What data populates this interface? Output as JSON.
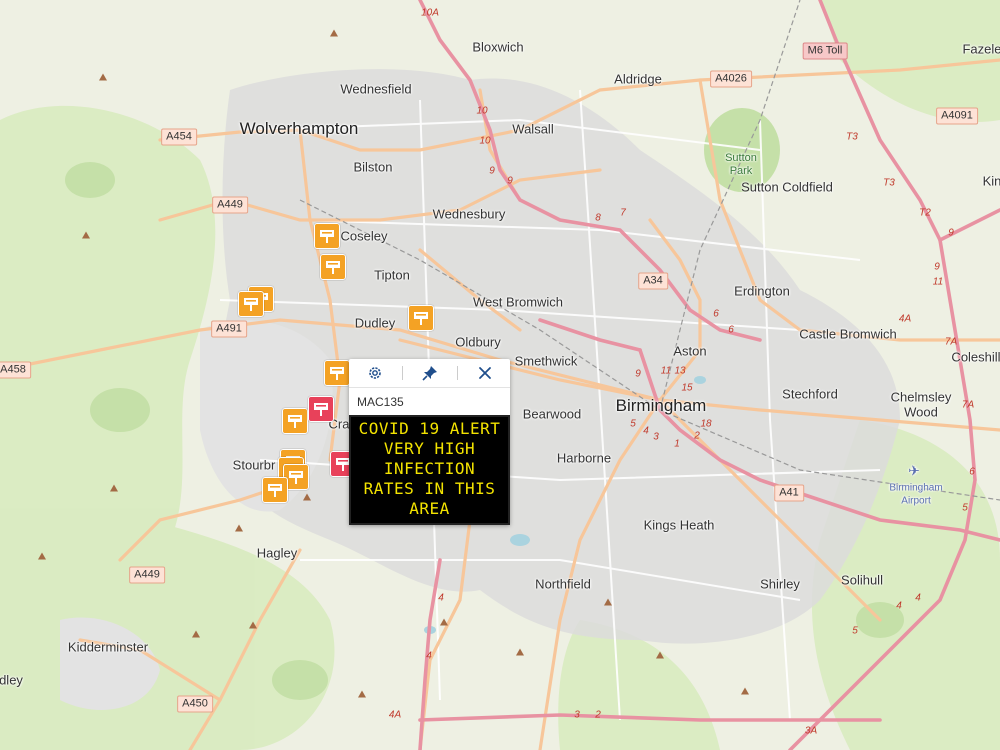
{
  "map": {
    "places": [
      {
        "name": "Wolverhampton",
        "kind": "city"
      },
      {
        "name": "Birmingham",
        "kind": "city"
      },
      {
        "name": "Bloxwich",
        "kind": "town"
      },
      {
        "name": "Wednesfield",
        "kind": "town"
      },
      {
        "name": "Walsall",
        "kind": "town"
      },
      {
        "name": "Aldridge",
        "kind": "town"
      },
      {
        "name": "Fazele",
        "kind": "town"
      },
      {
        "name": "Bilston",
        "kind": "town"
      },
      {
        "name": "Wednesbury",
        "kind": "town"
      },
      {
        "name": "Sutton Coldfield",
        "kind": "town"
      },
      {
        "name": "Coseley",
        "kind": "town"
      },
      {
        "name": "Tipton",
        "kind": "town"
      },
      {
        "name": "West Bromwich",
        "kind": "town"
      },
      {
        "name": "Erdington",
        "kind": "town"
      },
      {
        "name": "Dudley",
        "kind": "town"
      },
      {
        "name": "Oldbury",
        "kind": "town"
      },
      {
        "name": "Castle Bromwich",
        "kind": "town"
      },
      {
        "name": "Smethwick",
        "kind": "town"
      },
      {
        "name": "Aston",
        "kind": "town"
      },
      {
        "name": "Coleshill",
        "kind": "town"
      },
      {
        "name": "Stechford",
        "kind": "town"
      },
      {
        "name": "Chelmsley",
        "kind": "town"
      },
      {
        "name": "Wood",
        "kind": "town"
      },
      {
        "name": "Bearwood",
        "kind": "town"
      },
      {
        "name": "Harborne",
        "kind": "town"
      },
      {
        "name": "Stourbr",
        "kind": "town"
      },
      {
        "name": "Cra",
        "kind": "town"
      },
      {
        "name": "Kings Heath",
        "kind": "town"
      },
      {
        "name": "Hagley",
        "kind": "town"
      },
      {
        "name": "Solihull",
        "kind": "town"
      },
      {
        "name": "Shirley",
        "kind": "town"
      },
      {
        "name": "Northfield",
        "kind": "town"
      },
      {
        "name": "Kidderminster",
        "kind": "town"
      },
      {
        "name": "dley",
        "kind": "town"
      },
      {
        "name": "Kin",
        "kind": "town"
      }
    ],
    "parks": [
      "Sutton",
      "Park"
    ],
    "airport": [
      "Birmingham",
      "Airport"
    ],
    "roads": [
      "A454",
      "A449",
      "A491",
      "A458",
      "A4026",
      "A4091",
      "A34",
      "A41",
      "A449",
      "A450",
      "M6 Toll"
    ],
    "junctions": [
      "10A",
      "10",
      "10",
      "9",
      "9",
      "8",
      "7",
      "6",
      "6",
      "9",
      "11",
      "13",
      "15",
      "5",
      "4",
      "3",
      "1",
      "2",
      "18",
      "T3",
      "T3",
      "T2",
      "9",
      "9",
      "11",
      "4A",
      "7A",
      "7A",
      "6",
      "5",
      "4",
      "4",
      "4A",
      "3",
      "2",
      "3A",
      "5",
      "4",
      "4"
    ]
  },
  "markers": [
    {
      "type": "vms",
      "color": "#f4a224"
    },
    {
      "type": "vms",
      "color": "#f4a224"
    },
    {
      "type": "vms",
      "color": "#f4a224"
    },
    {
      "type": "vms",
      "color": "#f4a224"
    },
    {
      "type": "vms",
      "color": "#f4a224"
    },
    {
      "type": "vms",
      "color": "#f4a224"
    },
    {
      "type": "vms",
      "color": "#f4a224"
    },
    {
      "type": "vms",
      "color": "#f4a224"
    },
    {
      "type": "vms",
      "color": "#e8415a"
    },
    {
      "type": "vms",
      "color": "#f4a224"
    },
    {
      "type": "vms",
      "color": "#f4a224"
    },
    {
      "type": "vms",
      "color": "#f4a224"
    },
    {
      "type": "vms",
      "color": "#f4a224"
    },
    {
      "type": "vms",
      "color": "#e8415a"
    }
  ],
  "popup": {
    "title": "MAC135",
    "buttons": [
      "settings-icon",
      "pin-icon",
      "close-icon"
    ],
    "sign_lines": [
      "COVID 19 ALERT",
      "VERY HIGH",
      "INFECTION",
      "RATES IN THIS",
      "AREA"
    ],
    "sign_text_color": "#f3e300",
    "sign_background": "#000000"
  }
}
